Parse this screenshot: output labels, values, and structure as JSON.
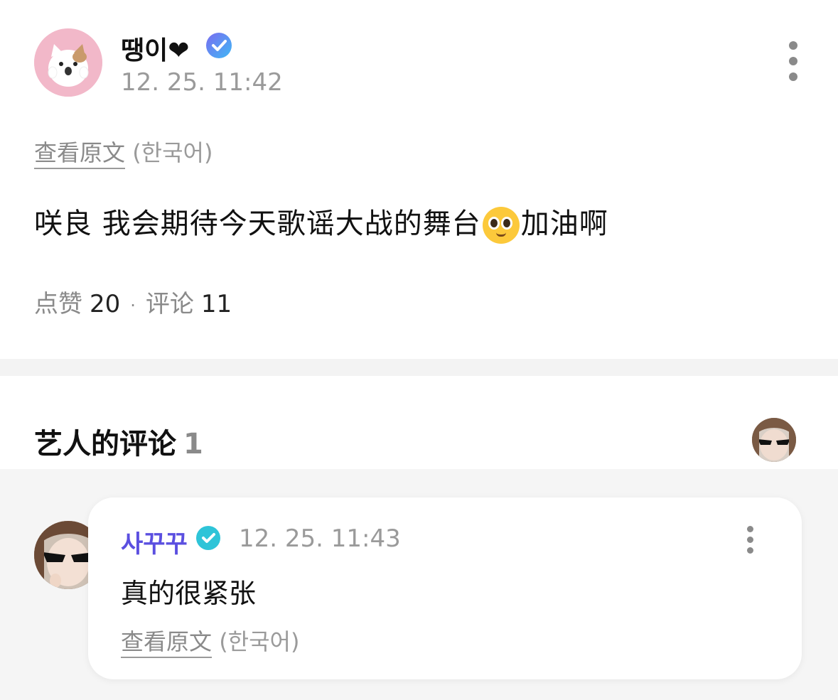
{
  "post": {
    "author_name": "땡이❤",
    "time": "12. 25. 11:42",
    "translate_link": "查看原文",
    "translate_lang": "(한국어)",
    "body_before": "咲良 我会期待今天歌谣大战的舞台",
    "body_emoji": "pleading-face-emoji",
    "body_after": "加油啊",
    "likes_label": "点赞",
    "likes_count": "20",
    "separator": "·",
    "comments_label": "评论",
    "comments_count": "11"
  },
  "artist_comments": {
    "title": "艺人的评论",
    "count": "1",
    "comment": {
      "author": "사꾸꾸",
      "time": "12. 25. 11:43",
      "text": "真的很紧张",
      "translate_link": "查看原文",
      "translate_lang": "(한국어)"
    }
  },
  "icons": {
    "more": "more-vertical-icon",
    "verified": "verified-badge-icon",
    "artist_badge": "artist-badge-icon"
  },
  "colors": {
    "artist_name": "#5b4fe0",
    "muted": "#9a9a9a",
    "divider": "#f3f3f3"
  }
}
